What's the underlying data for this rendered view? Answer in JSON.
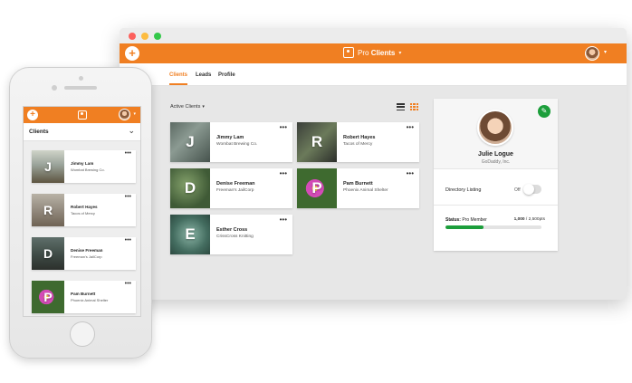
{
  "desktop": {
    "brand": {
      "prefix": "Pro",
      "name": "Clients"
    },
    "tabs": [
      {
        "label": "Clients",
        "active": true
      },
      {
        "label": "Leads",
        "active": false
      },
      {
        "label": "Profile",
        "active": false
      }
    ],
    "filter_label": "Active Clients",
    "cards": [
      {
        "initial": "J",
        "name": "Jimmy Lam",
        "org": "Wombat Brewing Co."
      },
      {
        "initial": "R",
        "name": "Robert Hayes",
        "org": "Tacos of Mercy"
      },
      {
        "initial": "D",
        "name": "Denise Freeman",
        "org": "Freeman's JailCorp"
      },
      {
        "initial": "P",
        "name": "Pam Burnett",
        "org": "Phoenix Animal Shelter"
      },
      {
        "initial": "E",
        "name": "Esther Cross",
        "org": "CrissCross Knitting"
      }
    ],
    "profile": {
      "name": "Julie Logue",
      "company": "GoDaddy, Inc.",
      "directory_label": "Directory Listing",
      "directory_state": "Off",
      "status_label": "Status:",
      "status_value": "Pro Member",
      "points_current": "1,000",
      "points_total": "/ 2,500pts",
      "progress_fraction": 0.4
    }
  },
  "phone": {
    "title": "Clients",
    "cards": [
      {
        "initial": "J",
        "name": "Jimmy Lam",
        "org": "Wombat Brewing Co."
      },
      {
        "initial": "R",
        "name": "Robert Hayes",
        "org": "Tacos of Mercy"
      },
      {
        "initial": "D",
        "name": "Denise Freeman",
        "org": "Freeman's JailCorp"
      },
      {
        "initial": "P",
        "name": "Pam Burnett",
        "org": "Phoenix Animal Shelter"
      }
    ]
  },
  "icons": {
    "add": "plus-icon",
    "more": "more-dots-icon",
    "edit": "pencil-icon",
    "list_view": "list-view-icon",
    "grid_view": "grid-view-icon"
  },
  "colors": {
    "brand_orange": "#f07f22",
    "success_green": "#1c9e3b"
  },
  "more_glyph": "•••",
  "add_glyph": "+",
  "caret_glyph": "▾",
  "chevron_glyph": "⌄",
  "edit_glyph": "✎"
}
